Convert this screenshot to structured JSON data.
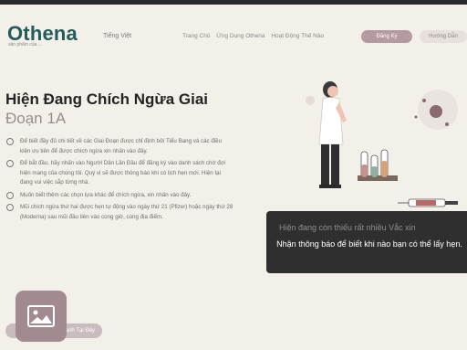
{
  "header": {
    "logo": "Othena",
    "logo_sub": "sản phẩm của ...",
    "language": "Tiếng Việt",
    "nav": [
      "Trang Chủ",
      "Ứng Dụng Othena",
      "Hoạt Động Thế Nào"
    ],
    "cta_label": "Đăng Ký",
    "secondary_label": "Hướng Dẫn"
  },
  "main": {
    "title_main": "Hiện Đang Chích Ngừa Giai",
    "title_accent": "Đoạn 1A",
    "items": [
      "Để biết đầy đủ chi tiết về các Giai Đoạn được chỉ định bởi Tiểu Bang và các điều kiện ưu tiên để được chích ngừa xin nhấn vào đây.",
      "Để bắt đầu, hãy nhấn vào Người Dân Lần Đầu để đăng ký vào danh sách chờ đợi hiện mang của chúng tôi. Quý vị sẽ được thông báo khi có lịch hẹn mới. Hiện tại đang vui việc sắp từng nhà.",
      "Muốn biết thêm các chọn lựa khác để chích ngừa, xin nhấn vào đây.",
      "Mũi chích ngừa thứ hai được hẹn tự động vào ngày thứ 21 (Pfizer) hoặc ngày thứ 28 (Moderna) sau mũi đầu tiên vào cùng giờ, cùng địa điểm."
    ],
    "bottom_button": "Lần Đầu Tiên Ghi Danh Tại Đây"
  },
  "banner": {
    "line1": "Hiện đang còn thiếu rất nhiều Vắc xin",
    "line2": "Nhận thông báo để biết khi nào bạn có thể lấy hẹn."
  },
  "colors": {
    "brand": "#245c5a",
    "accent": "#b59aa1",
    "banner": "#2f2f2f"
  }
}
